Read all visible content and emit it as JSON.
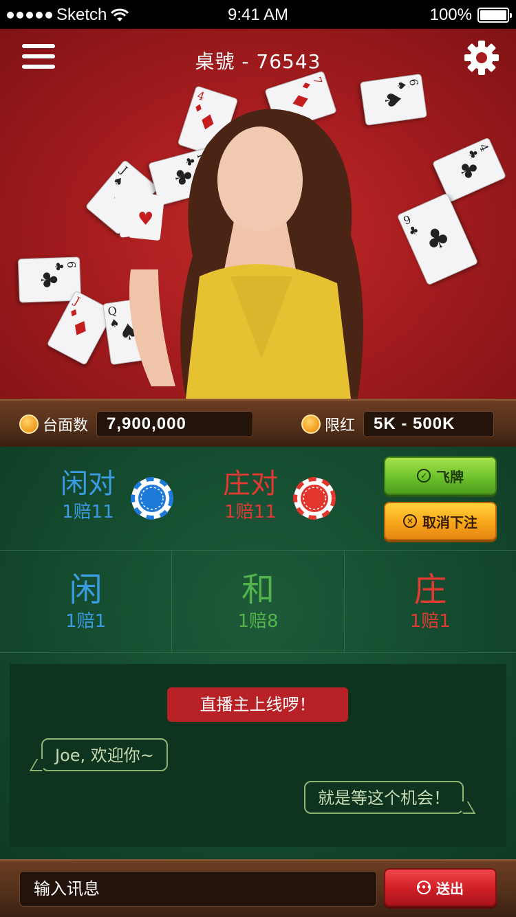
{
  "status": {
    "carrier": "Sketch",
    "time": "9:41 AM",
    "battery": "100%"
  },
  "header": {
    "title": "桌號 - 76543",
    "menu_icon": "menu-icon",
    "settings_icon": "gear-icon"
  },
  "info": {
    "table_label": "台面数",
    "table_value": "7,900,000",
    "limit_label": "限红",
    "limit_value": "5K - 500K"
  },
  "bets": {
    "player_pair": {
      "label": "闲对",
      "odds": "1赔11"
    },
    "banker_pair": {
      "label": "庄对",
      "odds": "1赔11"
    },
    "player": {
      "label": "闲",
      "odds": "1赔1"
    },
    "tie": {
      "label": "和",
      "odds": "1赔8"
    },
    "banker": {
      "label": "庄",
      "odds": "1赔1"
    }
  },
  "actions": {
    "fly_label": "飞牌",
    "cancel_label": "取消下注",
    "send_label": "送出"
  },
  "chat": {
    "announcement": "直播主上线啰！",
    "messages": [
      {
        "text": "Joe, 欢迎你~"
      },
      {
        "text": "就是等这个机会！"
      }
    ],
    "input_placeholder": "输入讯息"
  },
  "colors": {
    "player_blue": "#3a9be0",
    "banker_red": "#e03b33",
    "tie_green": "#52b449",
    "felt": "#144a2e",
    "hero_red": "#a71d1f"
  }
}
